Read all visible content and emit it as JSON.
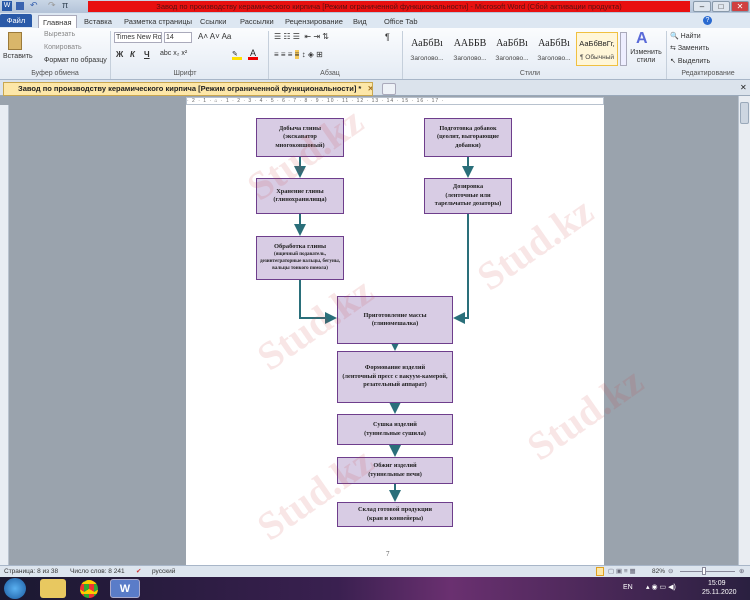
{
  "window": {
    "title": "Завод по производству керамического кирпича [Режим ограниченной функциональности] - Microsoft Word (Сбой активации продукта)",
    "min": "–",
    "max": "□",
    "close": "✕"
  },
  "tabs": [
    "Файл",
    "Главная",
    "Вставка",
    "Разметка страницы",
    "Ссылки",
    "Рассылки",
    "Рецензирование",
    "Вид",
    "Office Tab"
  ],
  "ribbon": {
    "clipboard": {
      "paste": "Вставить",
      "cut": "Вырезать",
      "copy": "Копировать",
      "format_painter": "Формат по образцу",
      "label": "Буфер обмена"
    },
    "font": {
      "name": "Times New Ro",
      "size": "14",
      "bold": "Ж",
      "italic": "К",
      "underline": "Ч",
      "label": "Шрифт"
    },
    "paragraph": {
      "label": "Абзац",
      "pilcrow": "¶"
    },
    "styles": {
      "items": [
        {
          "sample": "АаБбВı",
          "name": "Заголово..."
        },
        {
          "sample": "ААББВ",
          "name": "Заголово..."
        },
        {
          "sample": "АаБбВı",
          "name": "Заголово..."
        },
        {
          "sample": "АаБбВı",
          "name": "Заголово..."
        },
        {
          "sample": "АаБбВвГг,",
          "name": "¶ Обычный"
        }
      ],
      "change": "Изменить стили",
      "label": "Стили"
    },
    "editing": {
      "find": "Найти",
      "replace": "Заменить",
      "select": "Выделить",
      "label": "Редактирование"
    }
  },
  "doc_tab": {
    "title": "Завод по производству керамического кирпича [Режим ограниченной функциональности] *",
    "close": "✕"
  },
  "ruler": "· 2 · 1 · ⌂ · 1 · 2 · 3 · 4 · 5 · 6 · 7 · 8 · 9 · 10 · 11 · 12 · 13 · 14 · 15 · 16 · 17 ·",
  "flowchart": {
    "boxes": [
      {
        "title": "Добыча глины",
        "detail": "(экскаватор многоковшовый)"
      },
      {
        "title": "Подготовка добавок",
        "detail": "(цеолит, выгорающие добавки)"
      },
      {
        "title": "Хранение глины",
        "detail": "(глинохранилища)"
      },
      {
        "title": "Дозировка",
        "detail": "(ленточные или тарельчатые дозаторы)"
      },
      {
        "title": "Обработка глины",
        "detail": "(ящичный подаватель, дезинтеграторные вальцы, бегуны, вальцы тонкого помола)"
      },
      {
        "title": "Приготовление массы",
        "detail": "(глиномешалка)"
      },
      {
        "title": "Формование изделий",
        "detail": "(ленточный пресс с вакуум-камерой, резательный аппарат)"
      },
      {
        "title": "Сушка изделий",
        "detail": "(туннельные сушила)"
      },
      {
        "title": "Обжиг изделий",
        "detail": "(туннельные печи)"
      },
      {
        "title": "Склад готовой продукции",
        "detail": "(кран и конвейеры)"
      }
    ],
    "colors": {
      "fill": "#d8cce4",
      "border": "#6e3e8c",
      "arrow": "#2a6f7a"
    }
  },
  "page_number": "7",
  "watermark": "Stud.kz",
  "status": {
    "page": "Страница: 8 из 38",
    "words": "Число слов: 8 241",
    "language": "русский",
    "zoom": "82%"
  },
  "taskbar": {
    "lang": "EN",
    "time": "15:09",
    "date": "25.11.2020"
  }
}
